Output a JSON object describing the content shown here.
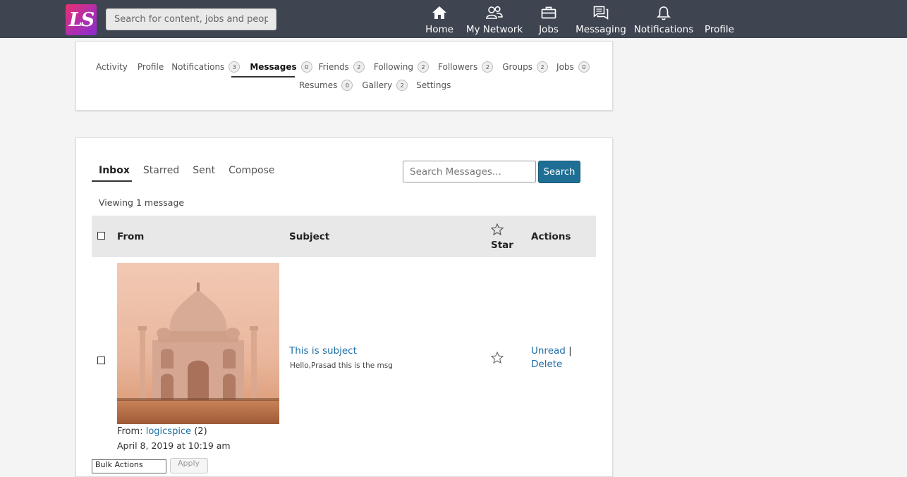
{
  "header": {
    "logo_text": "LS",
    "search_placeholder": "Search for content, jobs and people",
    "nav": [
      {
        "label": "Home",
        "icon": "home-icon"
      },
      {
        "label": "My Network",
        "icon": "network-icon"
      },
      {
        "label": "Jobs",
        "icon": "briefcase-icon"
      },
      {
        "label": "Messaging",
        "icon": "messaging-icon"
      },
      {
        "label": "Notifications",
        "icon": "bell-icon"
      },
      {
        "label": "Profile",
        "icon": ""
      }
    ]
  },
  "profile_nav": {
    "row1": [
      {
        "label": "Activity",
        "count": null
      },
      {
        "label": "Profile",
        "count": null
      },
      {
        "label": "Notifications",
        "count": "3"
      },
      {
        "label": "Messages",
        "count": "0",
        "active": true
      },
      {
        "label": "Friends",
        "count": "2"
      },
      {
        "label": "Following",
        "count": "2"
      },
      {
        "label": "Followers",
        "count": "2"
      },
      {
        "label": "Groups",
        "count": "2"
      },
      {
        "label": "Jobs",
        "count": "0"
      }
    ],
    "row2": [
      {
        "label": "Resumes",
        "count": "0"
      },
      {
        "label": "Gallery",
        "count": "2"
      },
      {
        "label": "Settings",
        "count": null
      }
    ]
  },
  "messages": {
    "tabs": [
      {
        "label": "Inbox",
        "active": true
      },
      {
        "label": "Starred"
      },
      {
        "label": "Sent"
      },
      {
        "label": "Compose"
      }
    ],
    "search_placeholder": "Search Messages...",
    "search_button": "Search",
    "viewing": "Viewing 1 message",
    "columns": {
      "from": "From",
      "subject": "Subject",
      "star": "Star",
      "actions": "Actions"
    },
    "rows": [
      {
        "from_prefix": "From:",
        "from_name": "logicspice",
        "from_count": "(2)",
        "date": "April 8, 2019 at 10:19 am",
        "subject": "This is subject",
        "excerpt": "Hello,Prasad this is the msg",
        "action_unread": "Unread",
        "action_sep": "|",
        "action_delete": "Delete"
      }
    ],
    "bulk_label": "Bulk Actions",
    "apply_label": "Apply"
  },
  "colors": {
    "topbar": "#3e4450",
    "accent": "#1f6f95",
    "link": "#1f6fa5"
  }
}
